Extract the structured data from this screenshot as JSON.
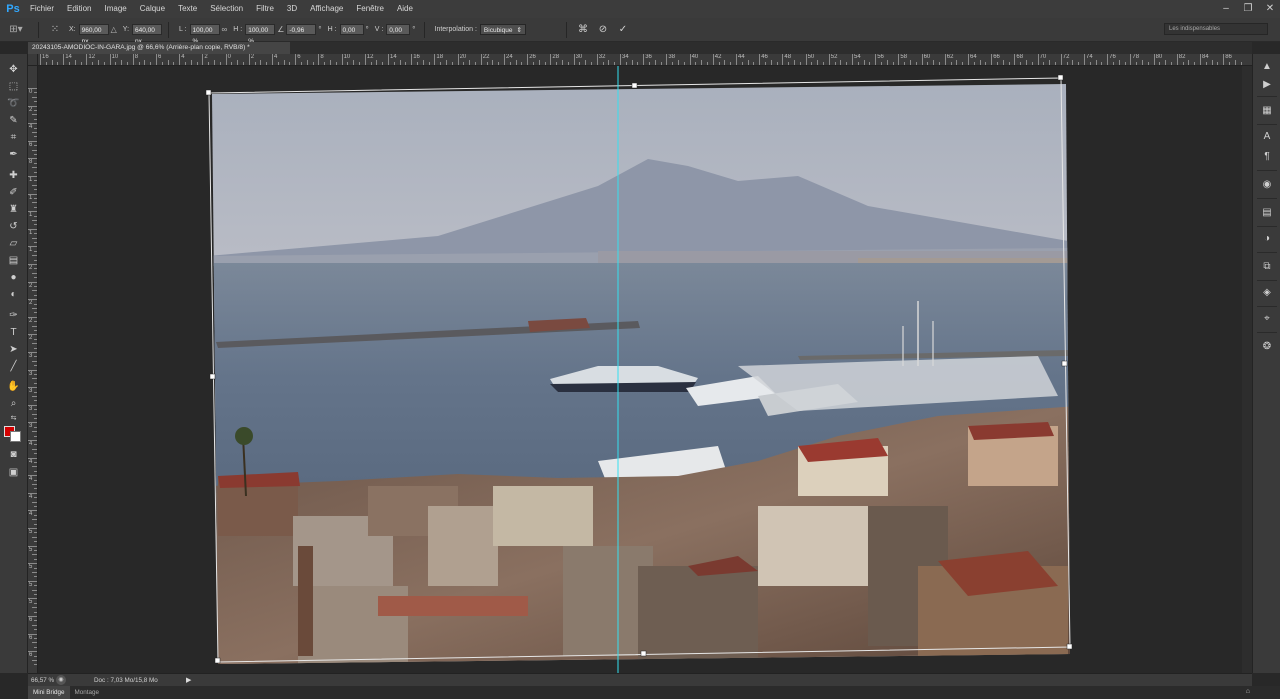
{
  "app": {
    "logo": "Ps"
  },
  "menu": [
    "Fichier",
    "Edition",
    "Image",
    "Calque",
    "Texte",
    "Sélection",
    "Filtre",
    "3D",
    "Affichage",
    "Fenêtre",
    "Aide"
  ],
  "options": {
    "x_label": "X:",
    "x_value": "960,00 px",
    "y_label": "Y:",
    "y_value": "640,00 px",
    "w_label": "L :",
    "w_value": "100,00 %",
    "h_label": "H :",
    "h_value": "100,00 %",
    "angle_value": "-0,96",
    "hskew_label": "H :",
    "hskew_value": "0,00",
    "vskew_label": "V :",
    "vskew_value": "0,00",
    "interp_label": "Interpolation :",
    "interp_value": "Bicubique",
    "workspace": "Les indispensables"
  },
  "document": {
    "tab_title": "20243105-AMODIOC-IN-GARA.jpg @ 66,6% (Arrière-plan copie, RVB/8) *"
  },
  "ruler": {
    "h_labels": [
      "16",
      "14",
      "12",
      "10",
      "8",
      "6",
      "4",
      "2",
      "0",
      "2",
      "4",
      "6",
      "8",
      "10",
      "12",
      "14",
      "16",
      "18",
      "20",
      "22",
      "24",
      "26",
      "28",
      "30",
      "32",
      "34",
      "36",
      "38",
      "40",
      "42",
      "44",
      "46",
      "48",
      "50",
      "52",
      "54",
      "56",
      "58",
      "60",
      "62",
      "64",
      "66",
      "68",
      "70",
      "72",
      "74",
      "76",
      "78",
      "80",
      "82",
      "84",
      "86",
      "88",
      "90"
    ],
    "v_labels": [
      "0",
      "2",
      "4",
      "6",
      "8",
      "1",
      "1",
      "1",
      "1",
      "1",
      "2",
      "2",
      "2",
      "2",
      "2",
      "3",
      "3",
      "3",
      "3",
      "3",
      "4",
      "4",
      "4",
      "4",
      "4",
      "5",
      "5",
      "5",
      "5",
      "5",
      "6",
      "6",
      "6",
      "6"
    ]
  },
  "status": {
    "zoom": "66,57 %",
    "doc": "Doc : 7,03 Mo/15,8 Mo"
  },
  "bottom_tabs": [
    "Mini Bridge",
    "Montage"
  ],
  "colors": {
    "foreground": "#d20000",
    "background": "#ffffff",
    "guide": "#35e0f0",
    "accent": "#31a8ff"
  }
}
